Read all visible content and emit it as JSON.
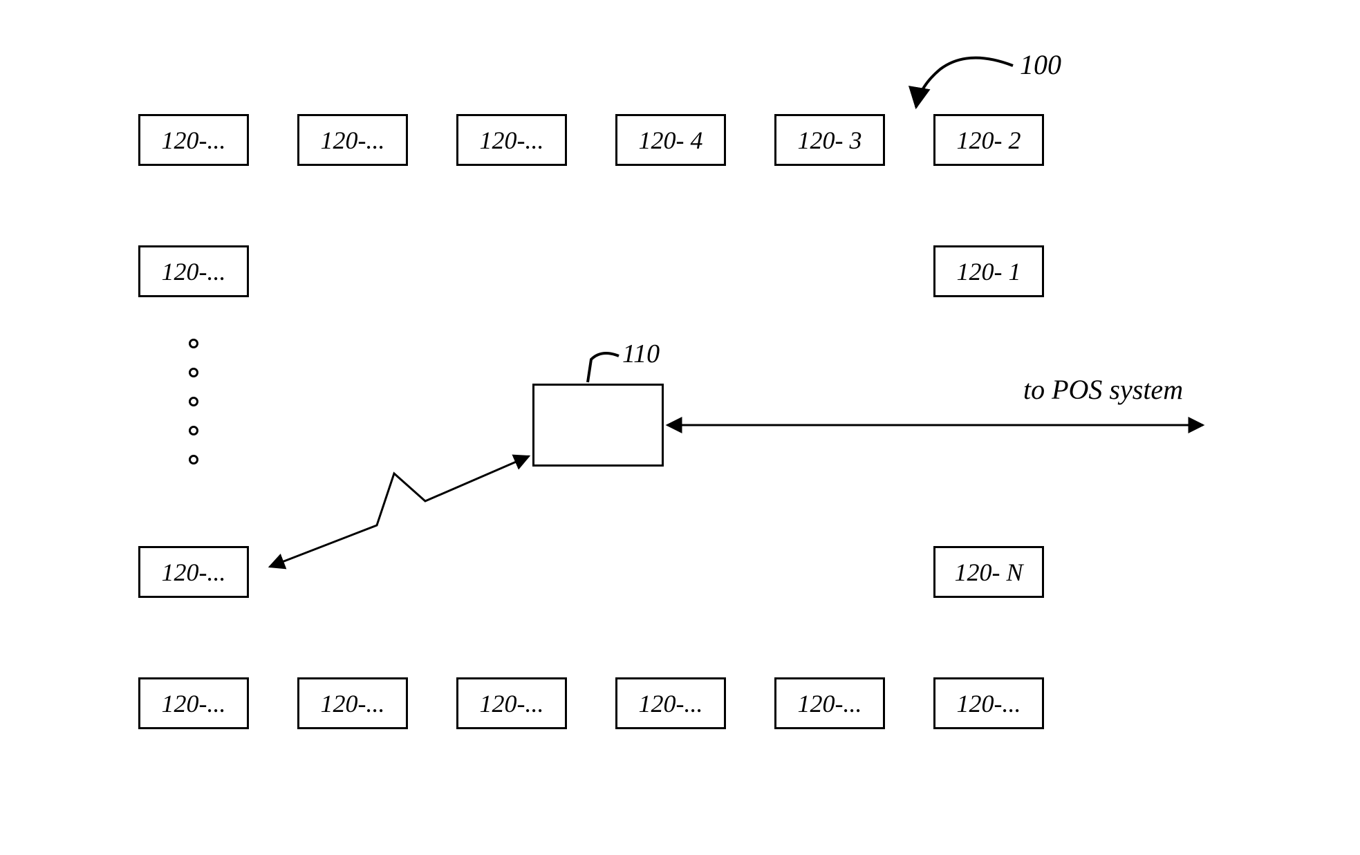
{
  "diagram": {
    "system_ref": "100",
    "central_ref": "110",
    "external_label": "to POS system",
    "nodes": {
      "top": [
        "120-...",
        "120-...",
        "120-...",
        "120- 4",
        "120- 3",
        "120- 2"
      ],
      "right_mid_upper": "120- 1",
      "left_mid_upper": "120-...",
      "left_mid_lower": "120-...",
      "right_mid_lower": "120- N",
      "bottom": [
        "120-...",
        "120-...",
        "120-...",
        "120-...",
        "120-...",
        "120-..."
      ]
    }
  }
}
